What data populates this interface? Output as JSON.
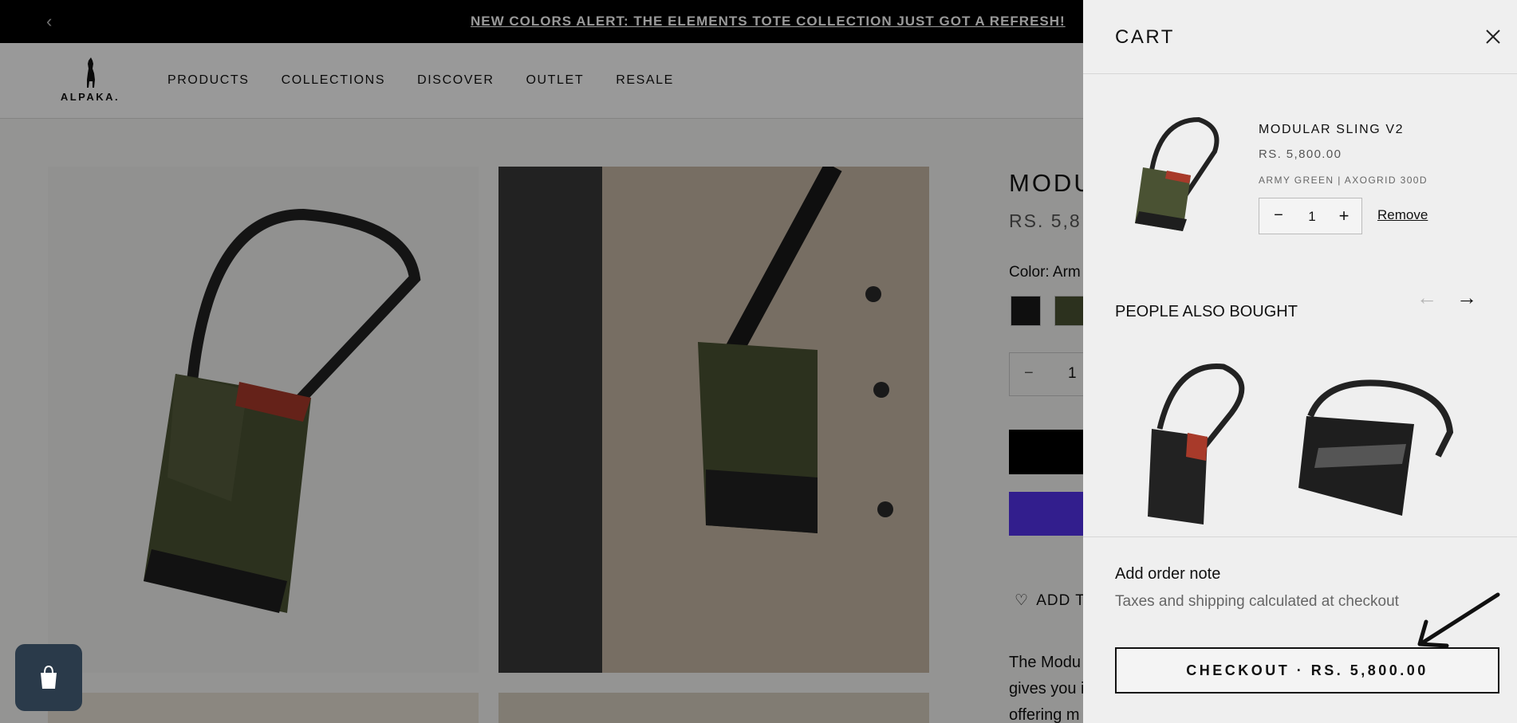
{
  "announcement": {
    "prev_icon": "chevron-left-icon",
    "message": "NEW COLORS ALERT: THE ELEMENTS TOTE COLLECTION JUST GOT A REFRESH!"
  },
  "header": {
    "logo_text": "ALPAKA.",
    "nav": [
      "PRODUCTS",
      "COLLECTIONS",
      "DISCOVER",
      "OUTLET",
      "RESALE"
    ]
  },
  "product": {
    "title": "MODU",
    "price": "RS. 5,8",
    "color_label": "Color: Arm",
    "quantity": "1",
    "wishlist_label": "ADD T",
    "description_lines": [
      "The Modu",
      "gives you i",
      "offering m"
    ]
  },
  "cart": {
    "title": "CART",
    "item": {
      "name": "MODULAR SLING V2",
      "price": "RS. 5,800.00",
      "variant": "ARMY GREEN | AXOGRID 300D",
      "quantity": "1",
      "remove_label": "Remove"
    },
    "recommendations": {
      "title": "PEOPLE ALSO BOUGHT",
      "prev_icon": "arrow-left-icon",
      "next_icon": "arrow-right-icon"
    },
    "order_note_label": "Add order note",
    "taxes_note": "Taxes and shipping calculated at checkout",
    "checkout_label": "CHECKOUT  ·  RS. 5,800.00"
  },
  "colors": {
    "announcement_bg": "#000000",
    "drawer_bg": "#efefef",
    "buy_button": "#5433eb",
    "army_green": "#4a5233"
  }
}
